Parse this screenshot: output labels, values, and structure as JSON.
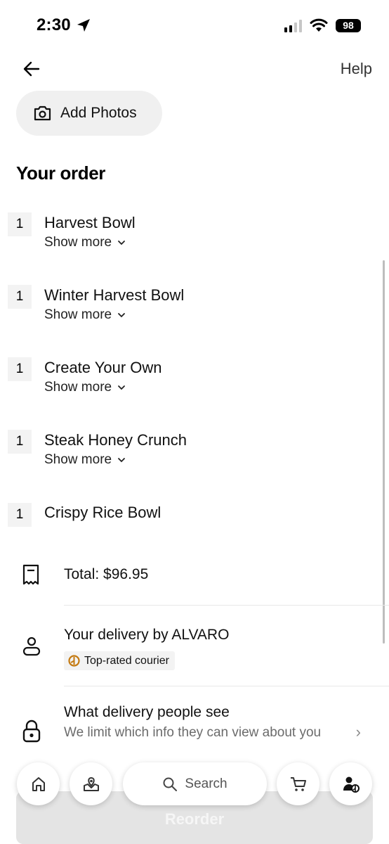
{
  "status_bar": {
    "time": "2:30",
    "battery": "98"
  },
  "header": {
    "help_label": "Help"
  },
  "add_photos": {
    "label": "Add Photos"
  },
  "order": {
    "title": "Your order",
    "items": [
      {
        "qty": "1",
        "name": "Harvest Bowl",
        "show_more": "Show more"
      },
      {
        "qty": "1",
        "name": "Winter Harvest Bowl",
        "show_more": "Show more"
      },
      {
        "qty": "1",
        "name": "Create Your Own",
        "show_more": "Show more"
      },
      {
        "qty": "1",
        "name": "Steak Honey Crunch",
        "show_more": "Show more"
      },
      {
        "qty": "1",
        "name": "Crispy Rice Bowl"
      }
    ]
  },
  "total": {
    "label": "Total: $96.95"
  },
  "delivery": {
    "label": "Your delivery by ALVARO",
    "badge": "Top-rated courier"
  },
  "privacy": {
    "title": "What delivery people see",
    "subtitle": "We limit which info they can view about you"
  },
  "bottom_nav": {
    "search_label": "Search",
    "reorder_label": "Reorder"
  },
  "icons": {
    "back": "arrow-left-icon",
    "camera": "camera-icon",
    "receipt": "receipt-icon",
    "person": "person-icon",
    "lock": "lock-icon",
    "home": "home-icon",
    "map": "map-pin-icon",
    "search": "search-icon",
    "cart": "cart-icon",
    "account": "account-icon"
  },
  "colors": {
    "badge_icon": "#c47a12",
    "chip_bg": "#f0f0f0"
  }
}
